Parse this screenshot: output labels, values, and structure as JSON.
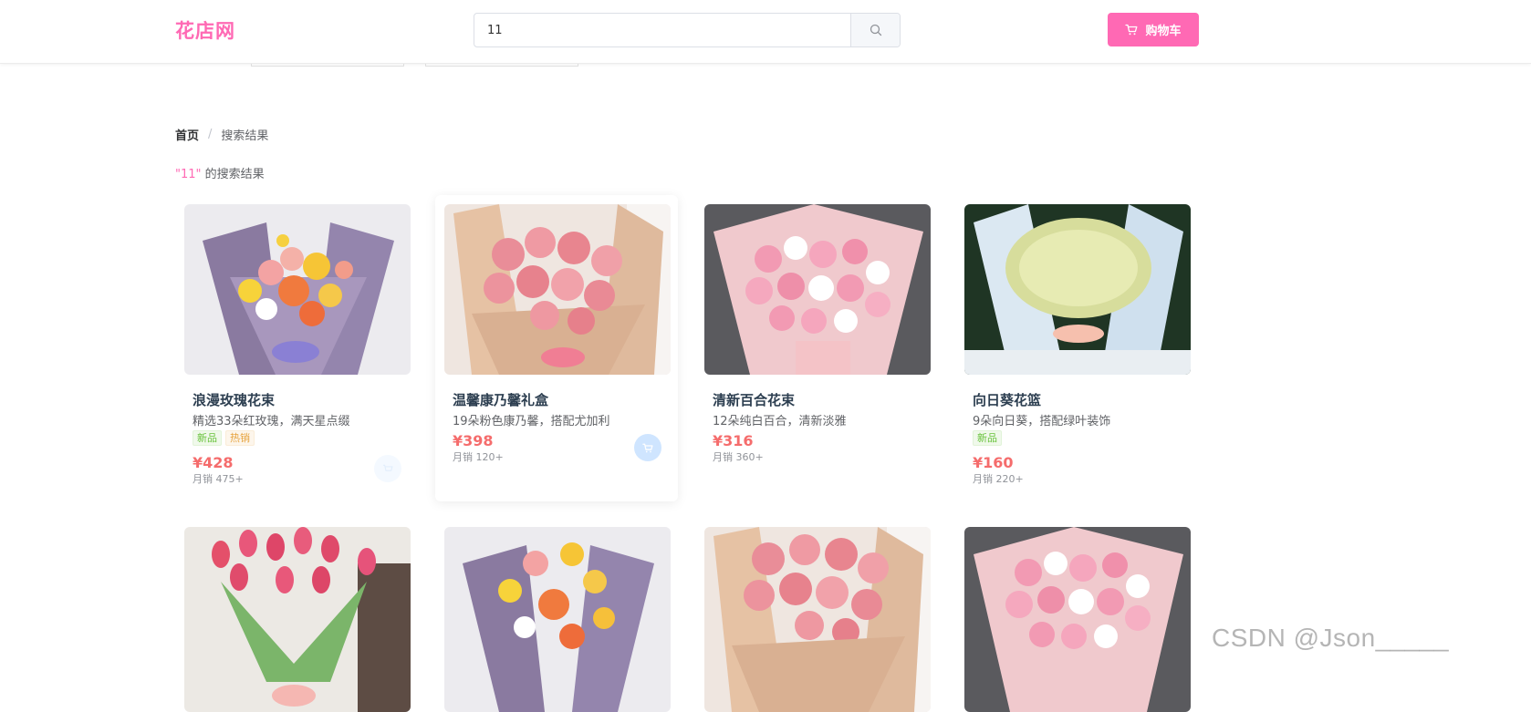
{
  "header": {
    "logo": "花店网",
    "search": {
      "value": "11"
    },
    "cart_label": "购物车"
  },
  "breadcrumb": {
    "home": "首页",
    "separator": "/",
    "current": "搜索结果"
  },
  "result_title": {
    "keyword": "\"11\"",
    "suffix": " 的搜索结果"
  },
  "products": [
    {
      "name": "浪漫玫瑰花束",
      "desc": "精选33朵红玫瑰，满天星点缀",
      "tags": [
        "新品",
        "热销"
      ],
      "price": "¥428",
      "sales": "月销 475+"
    },
    {
      "name": "温馨康乃馨礼盒",
      "desc": "19朵粉色康乃馨，搭配尤加利",
      "tags": [],
      "price": "¥398",
      "sales": "月销 120+"
    },
    {
      "name": "清新百合花束",
      "desc": "12朵纯白百合，清新淡雅",
      "tags": [],
      "price": "¥316",
      "sales": "月销 360+"
    },
    {
      "name": "向日葵花篮",
      "desc": "9朵向日葵，搭配绿叶装饰",
      "tags": [
        "新品"
      ],
      "price": "¥160",
      "sales": "月销 220+"
    }
  ],
  "watermark": "CSDN @Json_____",
  "colors": {
    "brand": "#ff69b4",
    "price": "#f56c6c",
    "tag_new": "#67c23a",
    "tag_hot": "#e6a23c"
  },
  "icons": {
    "search": "search-icon",
    "cart": "cart-icon",
    "add_to_cart": "cart-icon"
  }
}
